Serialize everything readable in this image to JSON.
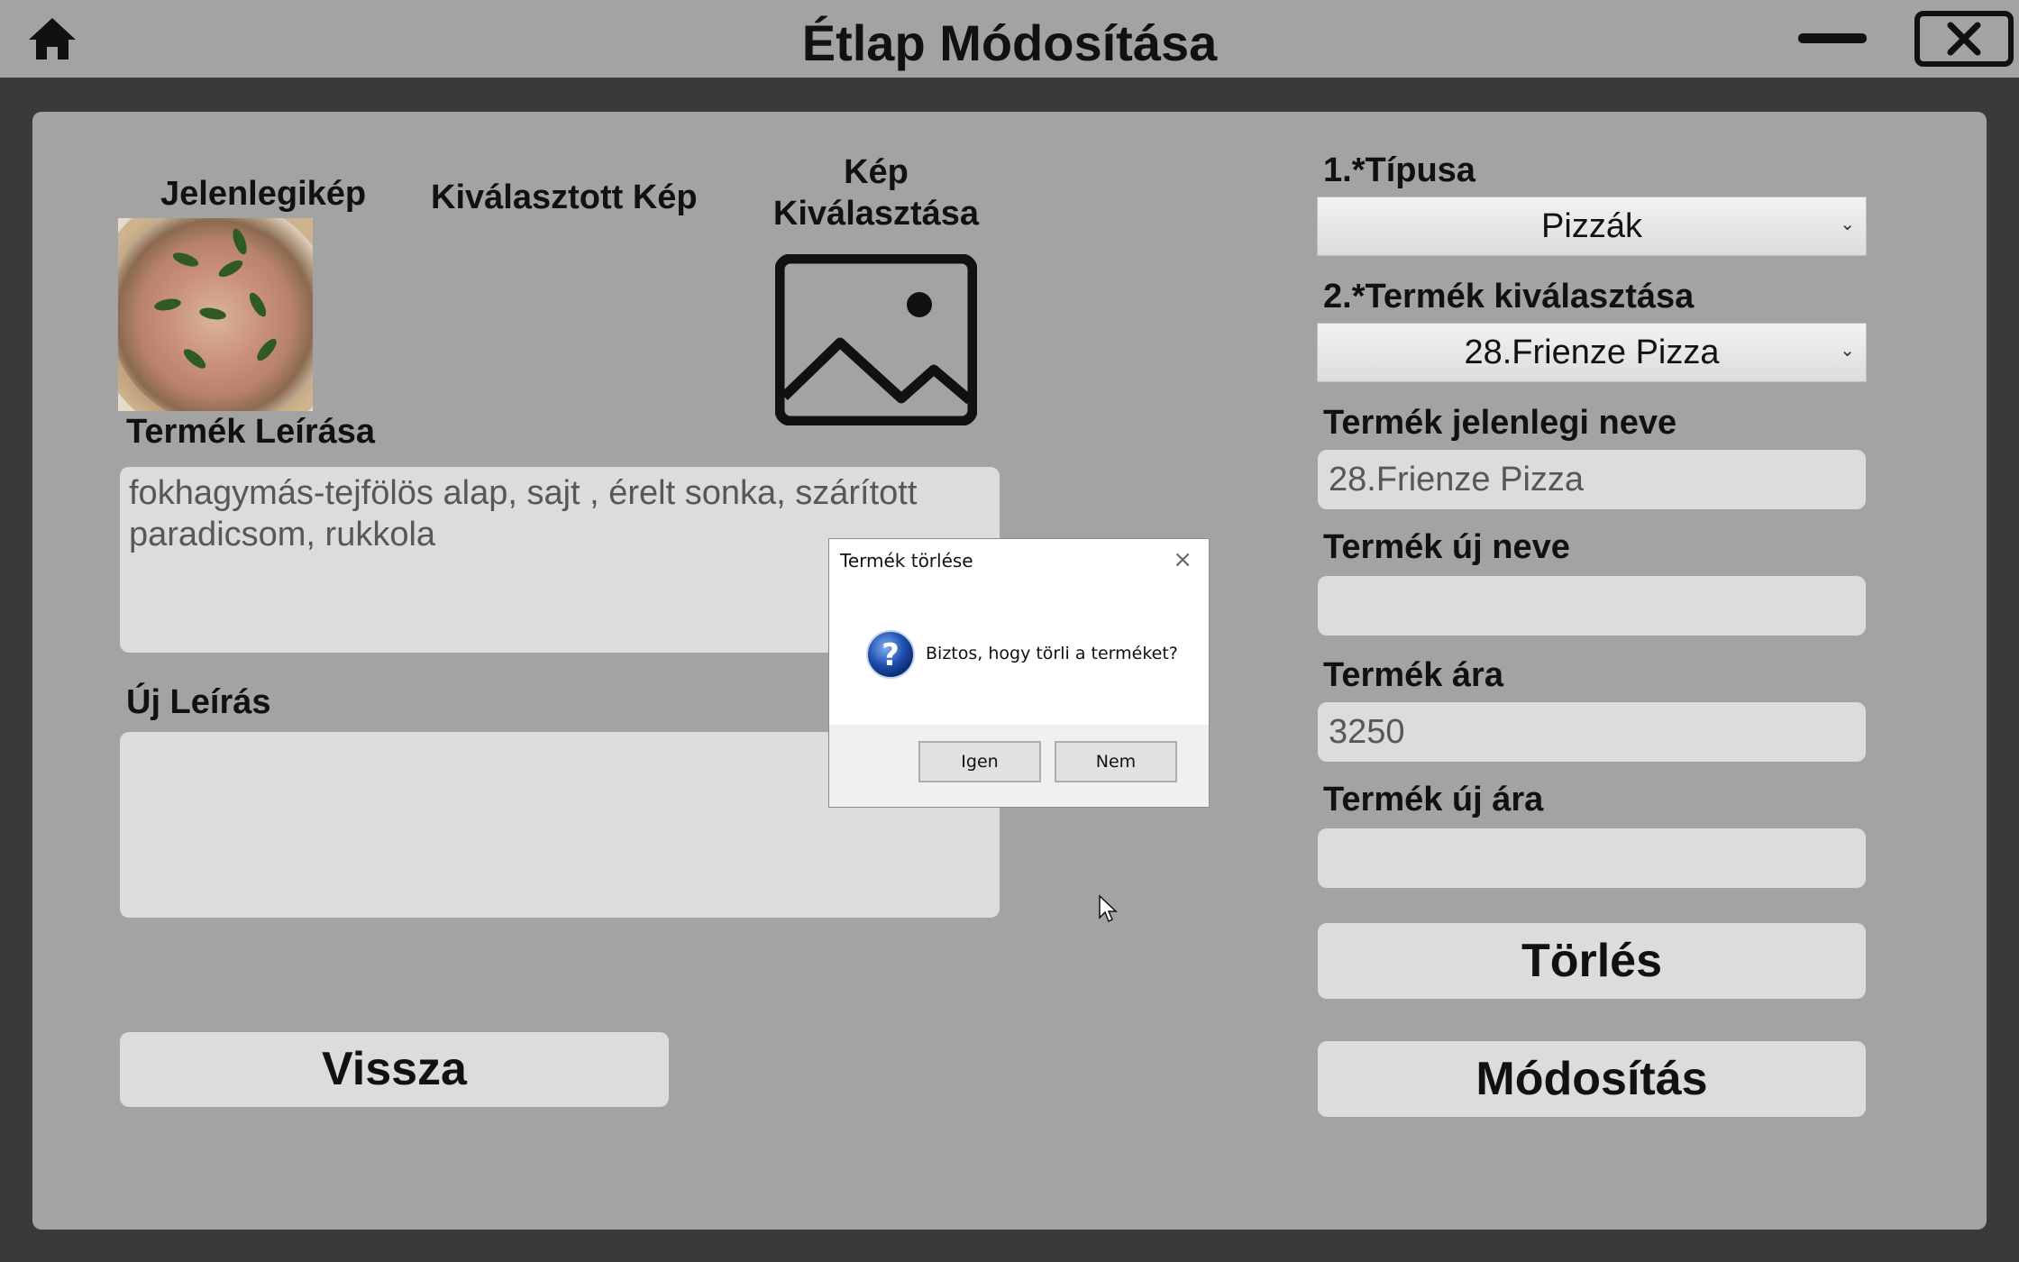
{
  "app": {
    "title": "Étlap Módosítása"
  },
  "left": {
    "current_image_label": "Jelenlegikép",
    "selected_image_label": "Kiválasztott Kép",
    "choose_image_label": "Kép Kiválasztása",
    "description_label": "Termék Leírása",
    "description_value": "fokhagymás-tejfölös alap, sajt , érelt sonka, szárított paradicsom, rukkola",
    "new_description_label": "Új Leírás",
    "new_description_value": "",
    "back_button": "Vissza"
  },
  "right": {
    "type_label": "1.*Típusa",
    "type_value": "Pizzák",
    "product_select_label": "2.*Termék kiválasztása",
    "product_select_value": "28.Frienze Pizza",
    "current_name_label": "Termék jelenlegi neve",
    "current_name_value": "28.Frienze Pizza",
    "new_name_label": "Termék új neve",
    "new_name_value": "",
    "price_label": "Termék ára",
    "price_value": "3250",
    "new_price_label": "Termék új ára",
    "new_price_value": "",
    "delete_button": "Törlés",
    "modify_button": "Módosítás"
  },
  "dialog": {
    "title": "Termék törlése",
    "message": "Biztos, hogy törli a terméket?",
    "yes": "Igen",
    "no": "Nem",
    "close": "×"
  }
}
